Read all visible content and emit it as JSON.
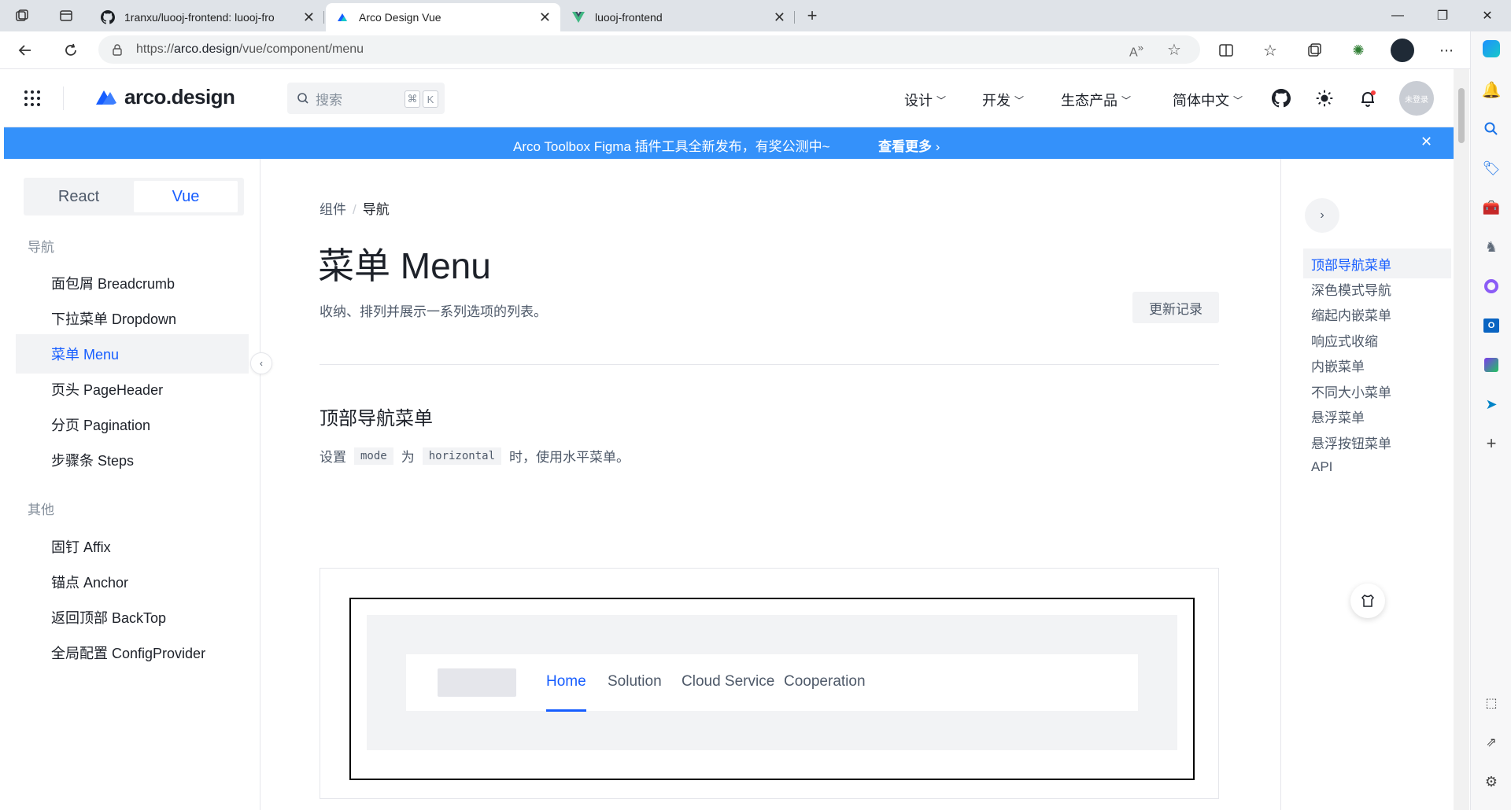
{
  "browser": {
    "tabs": [
      {
        "title": "1ranxu/luooj-frontend: luooj-fro",
        "active": false
      },
      {
        "title": "Arco Design Vue",
        "active": true
      },
      {
        "title": "luooj-frontend",
        "active": false
      }
    ],
    "url_prefix": "https://",
    "url_host": "arco.design",
    "url_path": "/vue/component/menu"
  },
  "header": {
    "logo_text": "arco.design",
    "search_placeholder": "搜索",
    "kbd_cmd": "⌘",
    "kbd_k": "K",
    "nav": [
      {
        "label": "设计"
      },
      {
        "label": "开发"
      },
      {
        "label": "生态产品"
      },
      {
        "label": "简体中文"
      }
    ],
    "avatar_text": "未登录"
  },
  "banner": {
    "message": "Arco Toolbox Figma 插件工具全新发布，有奖公测中~",
    "more": "查看更多"
  },
  "leftnav": {
    "switch": [
      "React",
      "Vue"
    ],
    "group1": "导航",
    "items1": [
      "面包屑 Breadcrumb",
      "下拉菜单 Dropdown",
      "菜单 Menu",
      "页头 PageHeader",
      "分页 Pagination",
      "步骤条 Steps"
    ],
    "group2": "其他",
    "items2": [
      "固钉 Affix",
      "锚点 Anchor",
      "返回顶部 BackTop",
      "全局配置 ConfigProvider"
    ]
  },
  "main": {
    "breadcrumb": [
      "组件",
      "导航"
    ],
    "title": "菜单 Menu",
    "description": "收纳、排列并展示一系列选项的列表。",
    "changelog": "更新记录",
    "section_title": "顶部导航菜单",
    "section_desc_1": "设置",
    "code_1": "mode",
    "section_desc_2": "为",
    "code_2": "horizontal",
    "section_desc_3": "时，使用水平菜单。",
    "demo_menu": [
      "Home",
      "Solution",
      "Cloud Service",
      "Cooperation"
    ]
  },
  "toc": {
    "items": [
      "顶部导航菜单",
      "深色模式导航",
      "缩起内嵌菜单",
      "响应式收缩",
      "内嵌菜单",
      "不同大小菜单",
      "悬浮菜单",
      "悬浮按钮菜单",
      "API"
    ]
  },
  "colors": {
    "primary": "#165dff",
    "banner": "#3491fa"
  }
}
